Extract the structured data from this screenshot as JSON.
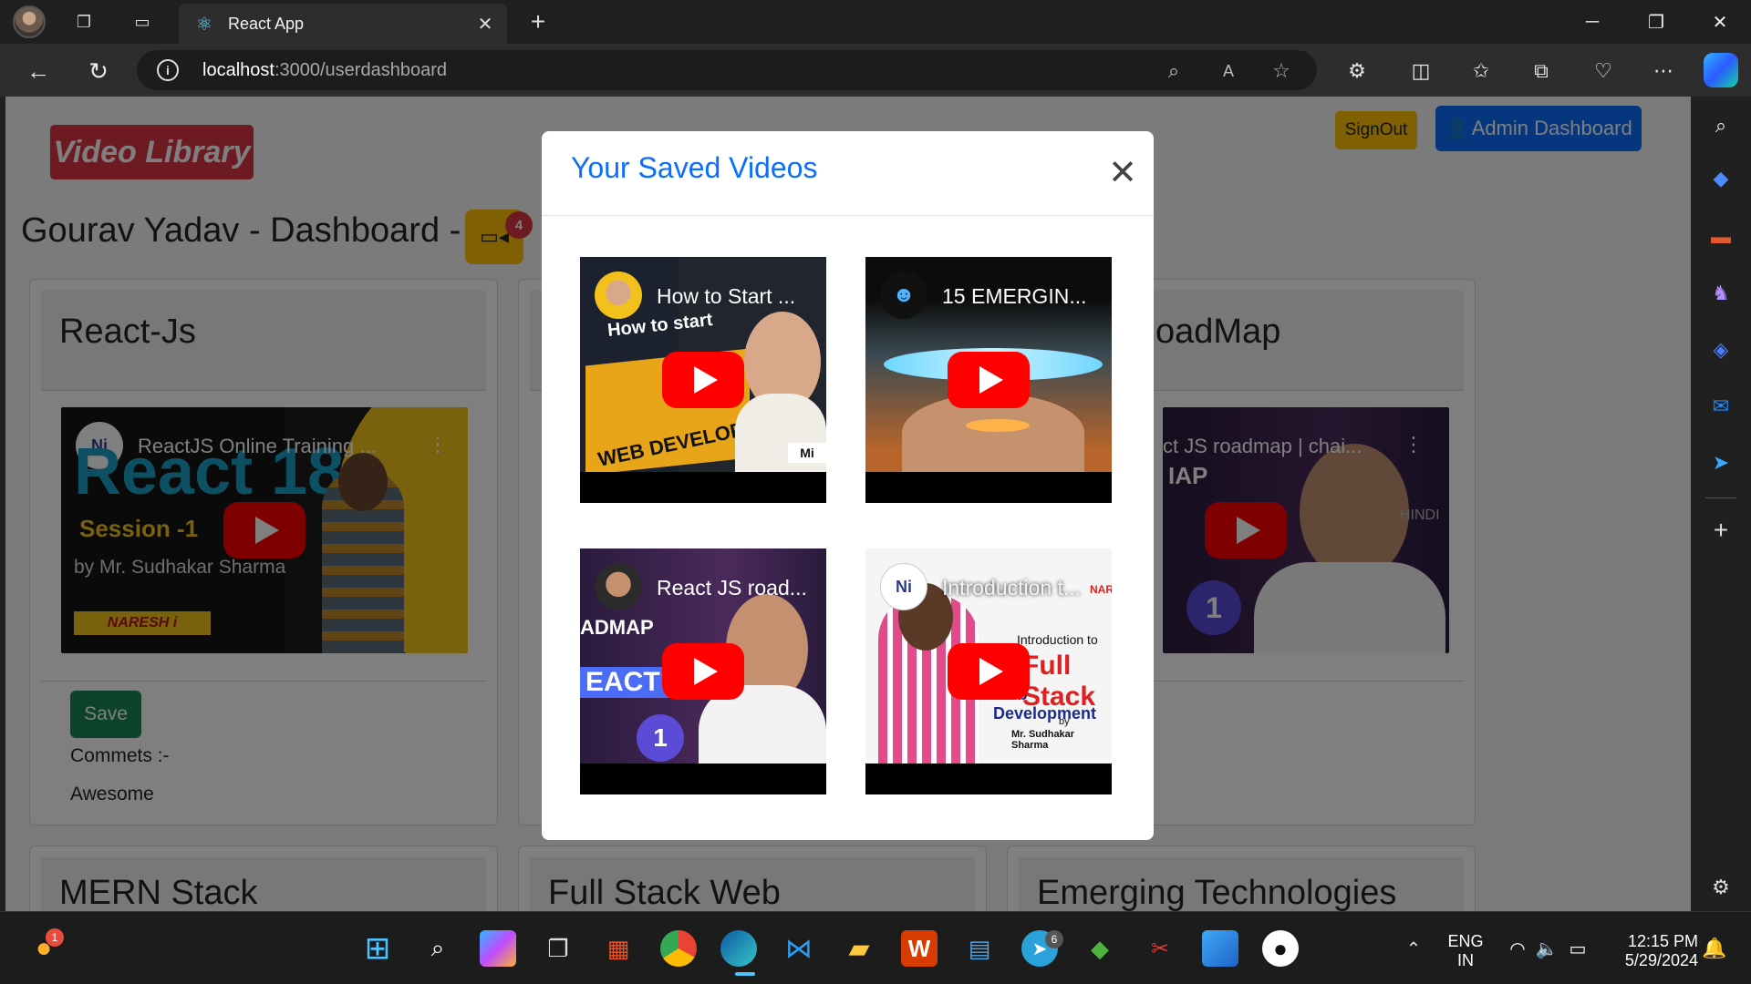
{
  "browser": {
    "tab_title": "React App",
    "url_host": "localhost",
    "url_path": ":3000/userdashboard"
  },
  "app": {
    "brand": "Video Library",
    "signout_label": "SignOut",
    "admin_label": "Admin Dashboard",
    "dashboard_title": "Gourav Yadav - Dashboard -",
    "saved_count": "4"
  },
  "cards": {
    "react": {
      "title": "React-Js",
      "video_title": "ReactJS Online Training ...",
      "thumb_big": "React 18",
      "thumb_session": "Session -1",
      "thumb_by": "by Mr. Sudhakar Sharma",
      "thumb_brand": "NARESH i",
      "save_label": "Save",
      "comments_label": "Commets :-",
      "comment": "Awesome"
    },
    "roadmap": {
      "title": "oadMap",
      "video_title": "ct JS roadmap | chai...",
      "thumb_text": "IAP",
      "thumb_lang": "HINDI",
      "thumb_num": "1"
    },
    "mern": {
      "title": "MERN Stack"
    },
    "fullstack": {
      "title": "Full Stack Web"
    },
    "emerging": {
      "title": "Emerging Technologies"
    }
  },
  "modal": {
    "title": "Your Saved Videos",
    "videos": [
      {
        "title": "How to Start ...",
        "overlay": "How to start",
        "overlay2": "WEB DEVELOPER",
        "corner": "Mi"
      },
      {
        "title": "15 EMERGIN..."
      },
      {
        "title": "React JS road...",
        "overlay": "ADMAP",
        "overlay2": "EACT JS",
        "num": "1"
      },
      {
        "title": "Introduction t...",
        "overlay": "Introduction to",
        "overlay2": "Full Stack",
        "overlay3": "Web Development",
        "by": "by",
        "author": "Mr. Sudhakar Sharma",
        "brand": "NAR"
      }
    ]
  },
  "taskbar": {
    "lang": "ENG",
    "region": "IN",
    "time": "12:15 PM",
    "date": "5/29/2024",
    "notif_count": "1",
    "telegram_count": "6"
  },
  "colors": {
    "danger": "#dc3545",
    "warning": "#ffc107",
    "primary": "#0d6efd",
    "success": "#198754"
  }
}
